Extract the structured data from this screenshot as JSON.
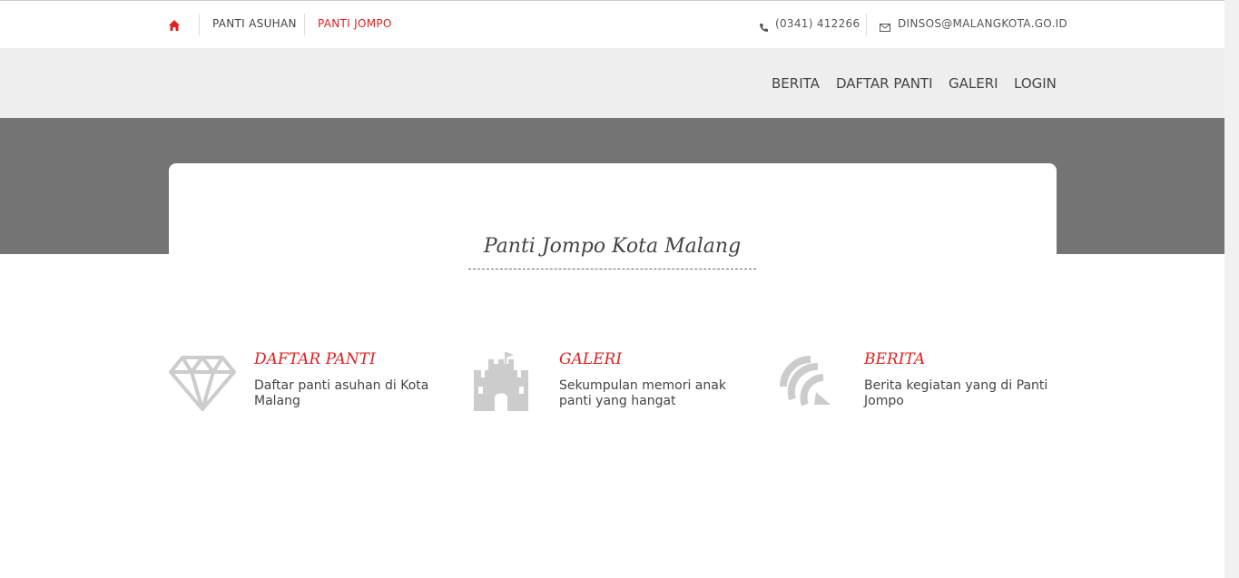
{
  "topbar": {
    "home_icon": "home-icon",
    "links": [
      "PANTI ASUHAN",
      "PANTI JOMPO"
    ],
    "phone": "(0341) 412266",
    "email": "DINSOS@MALANGKOTA.GO.ID",
    "phone_icon": "phone-icon",
    "email_icon": "envelope-icon"
  },
  "nav": {
    "items": [
      "BERITA",
      "DAFTAR PANTI",
      "GALERI",
      "LOGIN"
    ]
  },
  "hero": {
    "title": "Panti Jompo Kota Malang"
  },
  "features": [
    {
      "title": "DAFTAR PANTI",
      "description": "Daftar panti asuhan di Kota Malang",
      "icon": "diamond-icon"
    },
    {
      "title": "GALERI",
      "description": "Sekumpulan memori anak panti yang hangat",
      "icon": "castle-icon"
    },
    {
      "title": "BERITA",
      "description": "Berita kegiatan yang di Panti Jompo",
      "icon": "feed-icon"
    }
  ],
  "colors": {
    "accent": "#e02020",
    "nav_bg": "#eeeeee",
    "hero_bg": "#747474",
    "icon_gray": "#cccccc"
  }
}
